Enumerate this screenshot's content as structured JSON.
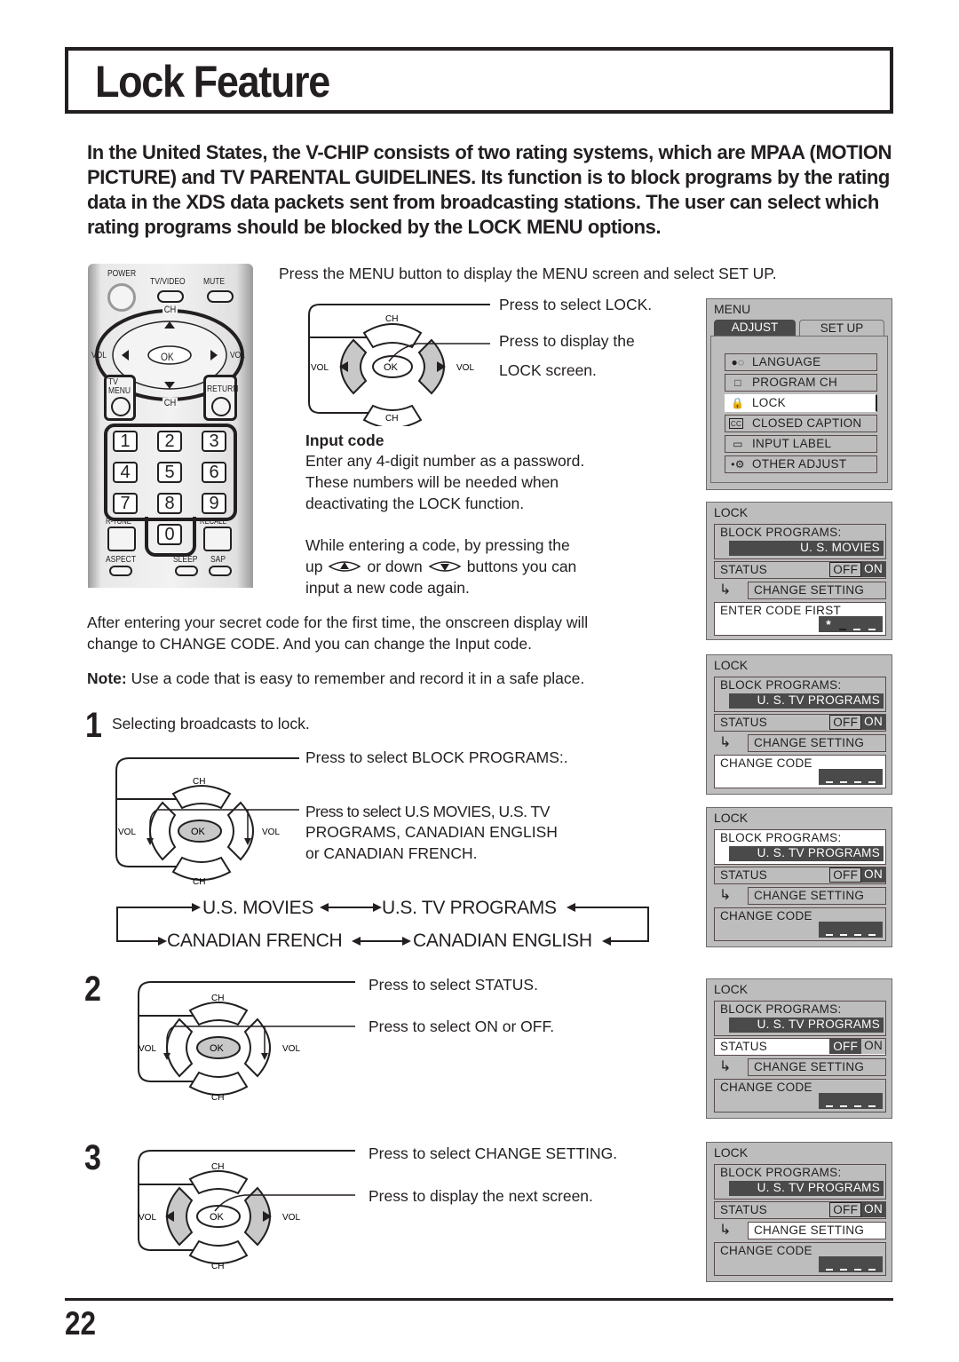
{
  "page": {
    "title": "Lock Feature",
    "intro": "In the United States, the V-CHIP consists of two rating systems, which are MPAA (MOTION PICTURE) and TV PARENTAL GUIDELINES. Its function is to block programs by the rating data in the XDS data packets sent from broadcasting stations. The user can select which rating programs should be blocked by the LOCK MENU options.",
    "page_number": "22"
  },
  "remote": {
    "power": "POWER",
    "tv_video": "TV/VIDEO",
    "mute": "MUTE",
    "ch": "CH",
    "vol": "VOL",
    "ok": "OK",
    "tv_menu_1": "TV",
    "tv_menu_2": "MENU",
    "return": "RETURN",
    "keys": [
      "1",
      "2",
      "3",
      "4",
      "5",
      "6",
      "7",
      "8",
      "9",
      "0"
    ],
    "r_tune": "R-TUNE",
    "recall": "RECALL",
    "aspect": "ASPECT",
    "sleep": "SLEEP",
    "sap": "SAP"
  },
  "setup": {
    "instruction": "Press the MENU button to display the MENU screen and select SET UP.",
    "press_select_lock": "Press to select LOCK.",
    "press_display_1": "Press to display the",
    "press_display_2": "LOCK screen.",
    "input_code_heading": "Input code",
    "input_code_text": [
      "Enter any 4-digit number as a password.",
      "These numbers will be needed when",
      "deactivating the LOCK function."
    ],
    "reenter_line1": "While entering a code, by pressing the",
    "reenter_up": "up",
    "reenter_or_down": "or down",
    "reenter_buttons": "buttons you can",
    "reenter_line3": "input a new code again.",
    "after_text": [
      "After entering your secret code for the first time, the onscreen display will",
      "change to CHANGE CODE. And you can change the Input code."
    ],
    "note_label": "Note:",
    "note_text": " Use a code that is easy to remember and record it in a safe place."
  },
  "steps": [
    {
      "number": "1",
      "title": "Selecting broadcasts to lock.",
      "lines": [
        "Press to select BLOCK PROGRAMS:.",
        "Press to select U.S MOVIES, U.S. TV",
        "PROGRAMS, CANADIAN ENGLISH",
        "or CANADIAN FRENCH."
      ]
    },
    {
      "number": "2",
      "lines": [
        "Press to select STATUS.",
        "Press to select ON or OFF."
      ]
    },
    {
      "number": "3",
      "lines": [
        "Press to select CHANGE SETTING.",
        "Press to display the next screen."
      ]
    }
  ],
  "cycle": {
    "us_movies": "U.S. MOVIES",
    "us_tv": "U.S. TV PROGRAMS",
    "canadian_french": "CANADIAN FRENCH",
    "canadian_english": "CANADIAN ENGLISH"
  },
  "keypad": {
    "ch": "CH",
    "vol": "VOL",
    "ok": "OK"
  },
  "osd_menu": {
    "title": "MENU",
    "tabs": [
      "ADJUST",
      "SET  UP"
    ],
    "active_tab": "SET  UP",
    "items": [
      {
        "icon": "language-icon",
        "label": "LANGUAGE"
      },
      {
        "icon": "program-ch-icon",
        "label": "PROGRAM  CH"
      },
      {
        "icon": "lock-icon",
        "label": "LOCK",
        "selected": true
      },
      {
        "icon": "cc-icon",
        "label": "CLOSED  CAPTION"
      },
      {
        "icon": "input-label-icon",
        "label": "INPUT  LABEL"
      },
      {
        "icon": "other-adjust-icon",
        "label": "OTHER  ADJUST"
      }
    ]
  },
  "osd_lock_screens": [
    {
      "title": "LOCK",
      "block_label": "BLOCK  PROGRAMS:",
      "block_value": "U. S.   MOVIES",
      "status": "STATUS",
      "off": "OFF",
      "on": "ON",
      "change_setting": "CHANGE  SETTING",
      "code_label": "ENTER  CODE  FIRST",
      "code": "* _ _ _",
      "selected": "code"
    },
    {
      "title": "LOCK",
      "block_label": "BLOCK  PROGRAMS:",
      "block_value": "U. S.  TV PROGRAMS",
      "status": "STATUS",
      "off": "OFF",
      "on": "ON",
      "change_setting": "CHANGE  SETTING",
      "code_label": "CHANGE CODE",
      "code": "_ _ _ _",
      "selected": "code"
    },
    {
      "title": "LOCK",
      "block_label": "BLOCK  PROGRAMS:",
      "block_value": "U. S.  TV PROGRAMS",
      "status": "STATUS",
      "off": "OFF",
      "on": "ON",
      "change_setting": "CHANGE  SETTING",
      "code_label": "CHANGE CODE",
      "code": "_ _ _ _",
      "selected": "block"
    },
    {
      "title": "LOCK",
      "block_label": "BLOCK  PROGRAMS:",
      "block_value": "U. S.  TV PROGRAMS",
      "status": "STATUS",
      "off": "OFF",
      "on": "ON",
      "change_setting": "CHANGE  SETTING",
      "code_label": "CHANGE CODE",
      "code": "_ _ _ _",
      "selected": "status"
    },
    {
      "title": "LOCK",
      "block_label": "BLOCK  PROGRAMS:",
      "block_value": "U. S.  TV PROGRAMS",
      "status": "STATUS",
      "off": "OFF",
      "on": "ON",
      "change_setting": "CHANGE  SETTING",
      "code_label": "CHANGE CODE",
      "code": "_ _ _ _",
      "selected": "change"
    }
  ],
  "colors": {
    "osd_bg": "#bdbdbd",
    "osd_dark": "#4a4a4a",
    "ink": "#231f20",
    "button_grey": "#cfcfcf"
  }
}
